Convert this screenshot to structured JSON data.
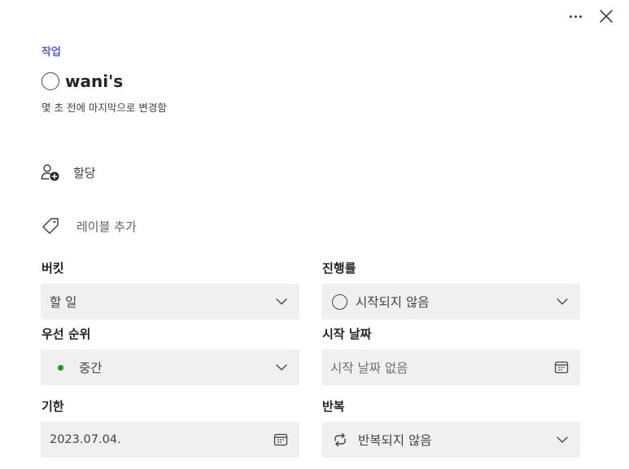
{
  "header": {
    "section_label": "작업",
    "task_title": "wani's",
    "modified_text": "몇 초 전에 마지막으로 변경함"
  },
  "actions": {
    "assign_label": "할당",
    "add_label_text": "레이블 추가"
  },
  "fields": {
    "bucket": {
      "label": "버킷",
      "value": "할 일"
    },
    "progress": {
      "label": "진행률",
      "value": "시작되지 않음"
    },
    "priority": {
      "label": "우선 순위",
      "value": "중간",
      "dot_color": "#13a10e"
    },
    "start_date": {
      "label": "시작 날짜",
      "placeholder": "시작 날짜 없음"
    },
    "due_date": {
      "label": "기한",
      "value": "2023.07.04."
    },
    "repeat": {
      "label": "반복",
      "value": "반복되지 않음"
    }
  },
  "colors": {
    "accent": "#5b5fc7",
    "field_background": "#f0f0f0",
    "priority_medium": "#13a10e"
  },
  "icons": {
    "more": "more-horizontal-icon",
    "close": "close-icon",
    "assign": "person-add-icon",
    "label": "tag-icon",
    "chevron": "chevron-down-icon",
    "calendar": "calendar-icon",
    "repeat": "repeat-icon"
  }
}
